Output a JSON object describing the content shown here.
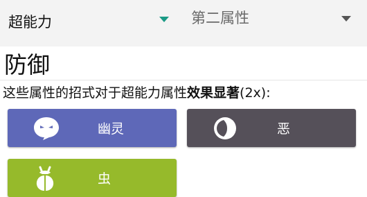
{
  "selectors": {
    "primary": "超能力",
    "secondary": "第二属性"
  },
  "section_title": "防御",
  "description": {
    "before": "这些属性的招式对于超能力属性",
    "emphasis": "效果显著",
    "after": "(2x):"
  },
  "types": [
    {
      "label": "幽灵",
      "icon": "ghost-icon",
      "color": "#5e68b8"
    },
    {
      "label": "恶",
      "icon": "dark-moon-icon",
      "color": "#555059"
    },
    {
      "label": "虫",
      "icon": "bug-icon",
      "color": "#96ba2b"
    }
  ],
  "colors": {
    "accent": "#1a9a85",
    "topbar": "#f3f3f3"
  }
}
